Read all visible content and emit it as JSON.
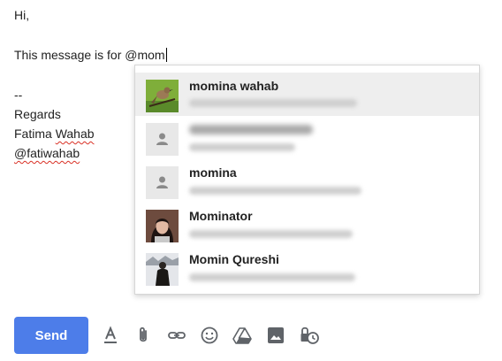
{
  "compose": {
    "greeting": "Hi,",
    "message_prefix": "This message is for ",
    "mention_query": "@mom",
    "separator": "--",
    "closing": "Regards",
    "sender_first": "Fatima ",
    "sender_last": "Wahab",
    "sender_handle": "@fatiwahab"
  },
  "suggestions": [
    {
      "name": "momina wahab",
      "avatar": "bird-photo-avatar",
      "active": true
    },
    {
      "name": "",
      "avatar": "generic-person-icon",
      "active": false
    },
    {
      "name": "momina",
      "avatar": "generic-person-icon",
      "active": false
    },
    {
      "name": "Mominator",
      "avatar": "woman-photo-avatar",
      "active": false
    },
    {
      "name": "Momin Qureshi",
      "avatar": "man-snow-photo-avatar",
      "active": false
    }
  ],
  "toolbar": {
    "send_label": "Send",
    "icons": [
      "format-text-icon",
      "attach-icon",
      "link-icon",
      "emoji-icon",
      "drive-icon",
      "photo-icon",
      "confidential-mode-icon"
    ],
    "accent": "#4d7de9"
  }
}
